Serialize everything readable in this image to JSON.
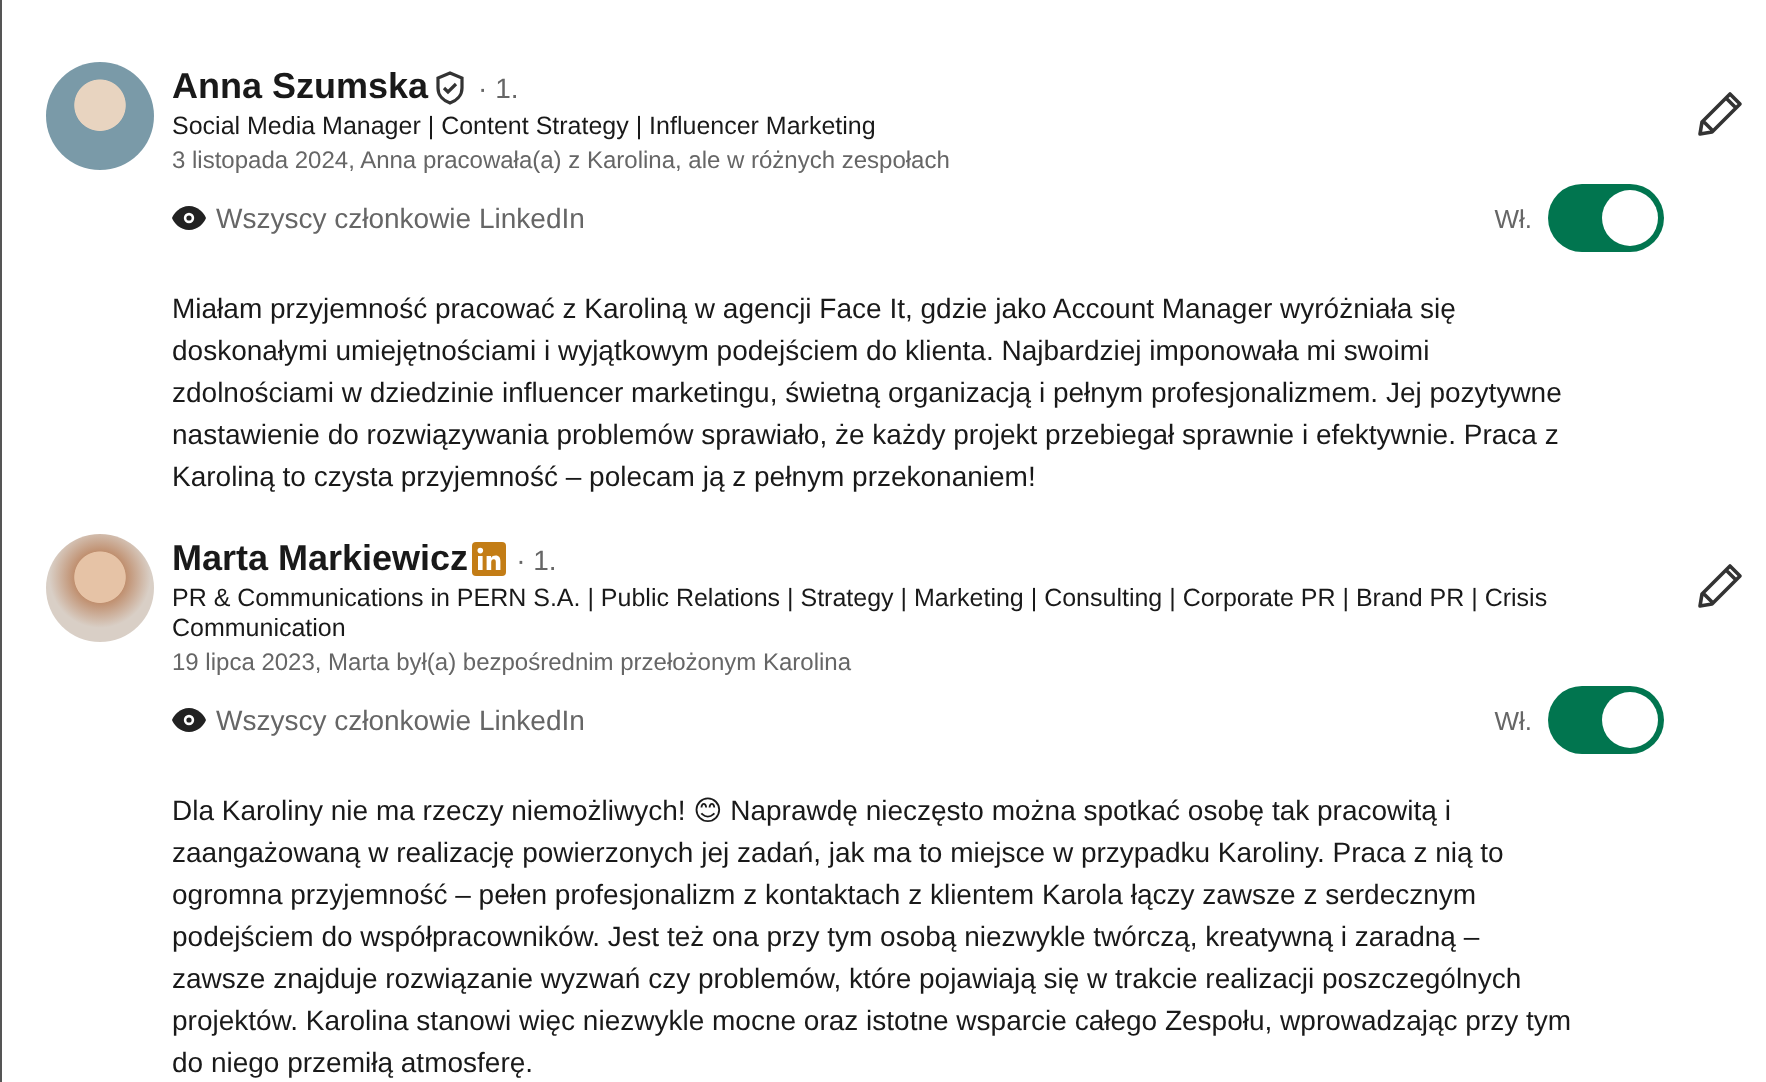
{
  "recommendations": [
    {
      "name": "Anna Szumska",
      "kind": "verified",
      "degree": "· 1.",
      "headline": "Social Media Manager | Content Strategy | Influencer Marketing",
      "meta": "3 listopada 2024, Anna pracowała(a) z Karolina, ale w różnych zespołach",
      "visibility": "Wszyscy członkowie LinkedIn",
      "toggle_label": "Wł.",
      "on": true,
      "text": "Miałam przyjemność pracować z Karoliną w agencji Face It, gdzie jako Account Manager wyróżniała się doskonałymi umiejętnościami i wyjątkowym podejściem do klienta. Najbardziej imponowała mi swoimi zdolnościami w dziedzinie influencer marketingu, świetną organizacją i pełnym profesjonalizmem. Jej pozytywne nastawienie do rozwiązywania problemów sprawiało, że każdy projekt przebiegał sprawnie i efektywnie. Praca z Karoliną to czysta przyjemność – polecam ją z pełnym przekonaniem!"
    },
    {
      "name": "Marta Markiewicz",
      "kind": "premium",
      "degree": "· 1.",
      "headline": "PR & Communications in PERN S.A. | Public Relations | Strategy | Marketing | Consulting | Corporate PR | Brand PR | Crisis Communication",
      "meta": "19 lipca 2023, Marta był(a) bezpośrednim przełożonym Karolina",
      "visibility": "Wszyscy członkowie LinkedIn",
      "toggle_label": "Wł.",
      "on": true,
      "text": "Dla Karoliny nie ma rzeczy niemożliwych! 😊 Naprawdę nieczęsto można spotkać osobę tak pracowitą i zaangażowaną w realizację powierzonych jej zadań, jak ma to miejsce w przypadku Karoliny. Praca z nią to ogromna przyjemność – pełen profesjonalizm z kontaktach z klientem Karola łączy zawsze z serdecznym podejściem do współpracowników. Jest też ona przy tym osobą niezwykle twórczą, kreatywną i zaradną – zawsze znajduje rozwiązanie wyzwań czy problemów, które pojawiają się w trakcie realizacji poszczególnych projektów. Karolina stanowi więc niezwykle mocne oraz istotne wsparcie całego Zespołu, wprowadzając przy tym do niego przemiłą atmosferę."
    }
  ]
}
